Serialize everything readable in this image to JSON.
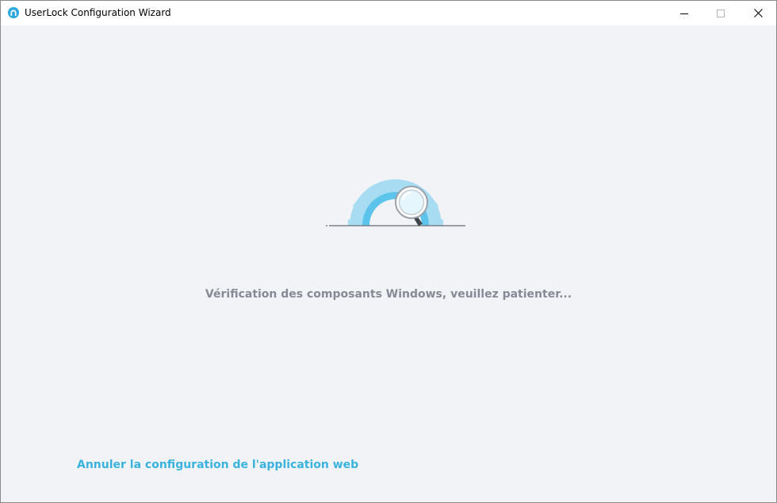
{
  "window": {
    "title": "UserLock Configuration Wizard"
  },
  "main": {
    "status_message": "Vérification des composants Windows, veuillez patienter...",
    "cancel_link": "Annuler la configuration de l'application web"
  },
  "colors": {
    "accent": "#39b3de",
    "gear_light": "#a8dcf3",
    "gear_dark": "#5cc3ea",
    "status_text": "#868a96",
    "background": "#f2f3f7"
  },
  "icons": {
    "app": "userlock-logo-icon",
    "illustration": "gear-magnifier-icon"
  }
}
